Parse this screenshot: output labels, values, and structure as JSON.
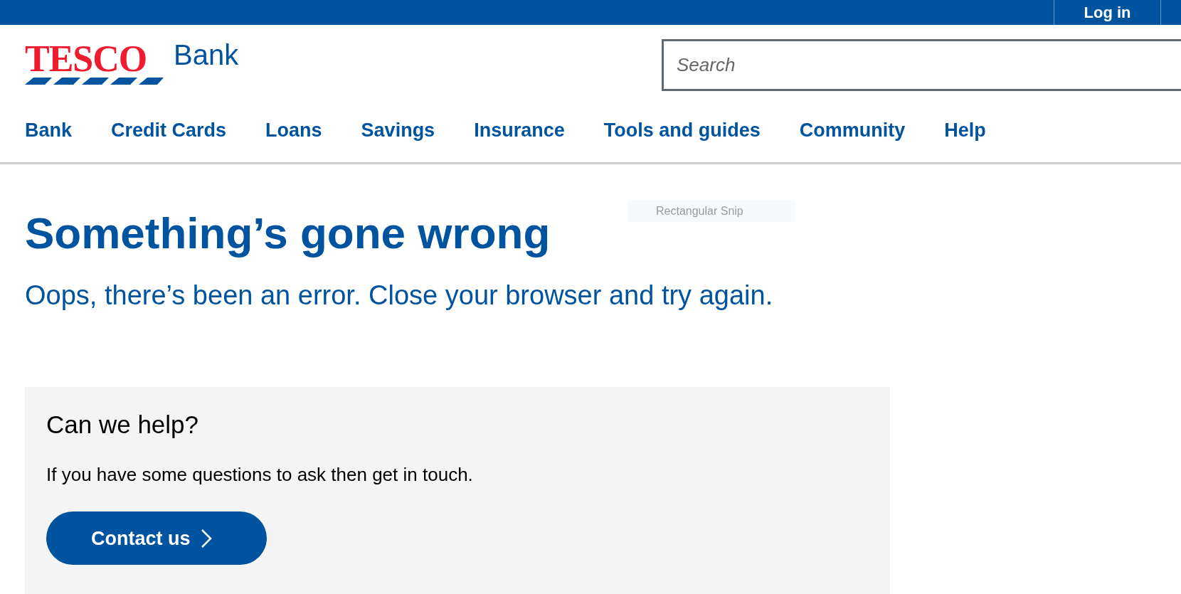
{
  "top_bar": {
    "login": "Log in"
  },
  "logo": {
    "brand": "TESCO",
    "product": "Bank"
  },
  "search": {
    "placeholder": "Search"
  },
  "nav": [
    "Bank",
    "Credit Cards",
    "Loans",
    "Savings",
    "Insurance",
    "Tools and guides",
    "Community",
    "Help"
  ],
  "tooltip": "Rectangular Snip",
  "error": {
    "title": "Something’s gone wrong",
    "message": "Oops, there’s been an error. Close your browser and try again."
  },
  "help_box": {
    "title": "Can we help?",
    "text": "If you have some questions to ask then get in touch.",
    "button": "Contact us"
  }
}
